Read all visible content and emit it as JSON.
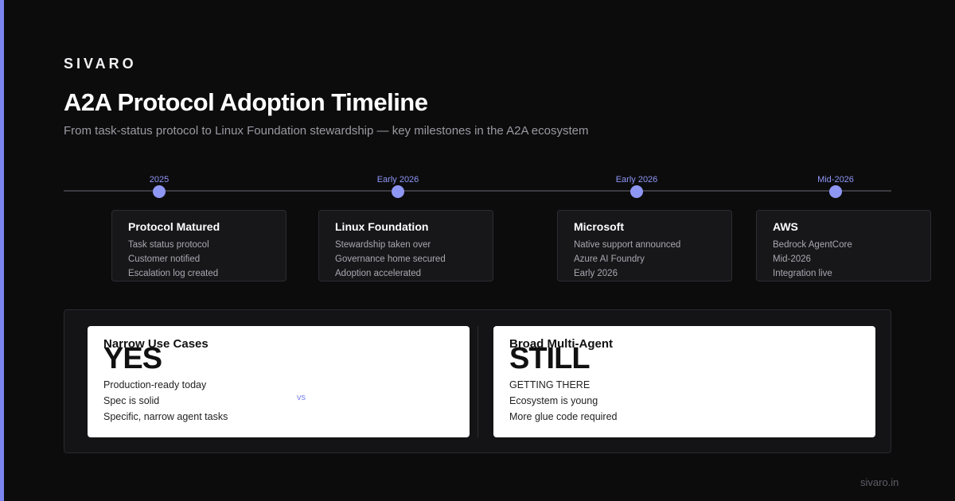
{
  "brand": "SIVARO",
  "title": "A2A Protocol Adoption Timeline",
  "subtitle": "From task-status protocol to Linux Foundation stewardship — key milestones in the A2A ecosystem",
  "timeline": [
    {
      "date": "2025",
      "title": "Protocol Matured",
      "lines": [
        "Task status protocol",
        "Customer notified",
        "Escalation log created"
      ]
    },
    {
      "date": "Early 2026",
      "title": "Linux Foundation",
      "lines": [
        "Stewardship taken over",
        "Governance home secured",
        "Adoption accelerated"
      ]
    },
    {
      "date": "Early 2026",
      "title": "Microsoft",
      "lines": [
        "Native support announced",
        "Azure AI Foundry",
        "Early 2026"
      ]
    },
    {
      "date": "Mid-2026",
      "title": "AWS",
      "lines": [
        "Bedrock AgentCore",
        "Mid-2026",
        "Integration live"
      ]
    }
  ],
  "comparison": {
    "vs_label": "vs",
    "left": {
      "title": "Narrow Use Cases",
      "big": "YES",
      "lines": [
        "Production-ready today",
        "Spec is solid",
        "Specific, narrow agent tasks"
      ]
    },
    "right": {
      "title": "Broad Multi-Agent",
      "big": "STILL",
      "lines": [
        "GETTING THERE",
        "Ecosystem is young",
        "More glue code required"
      ]
    }
  },
  "footer": "sivaro.in",
  "colors": {
    "accent": "#7b85f0",
    "background": "#0c0c0d"
  }
}
